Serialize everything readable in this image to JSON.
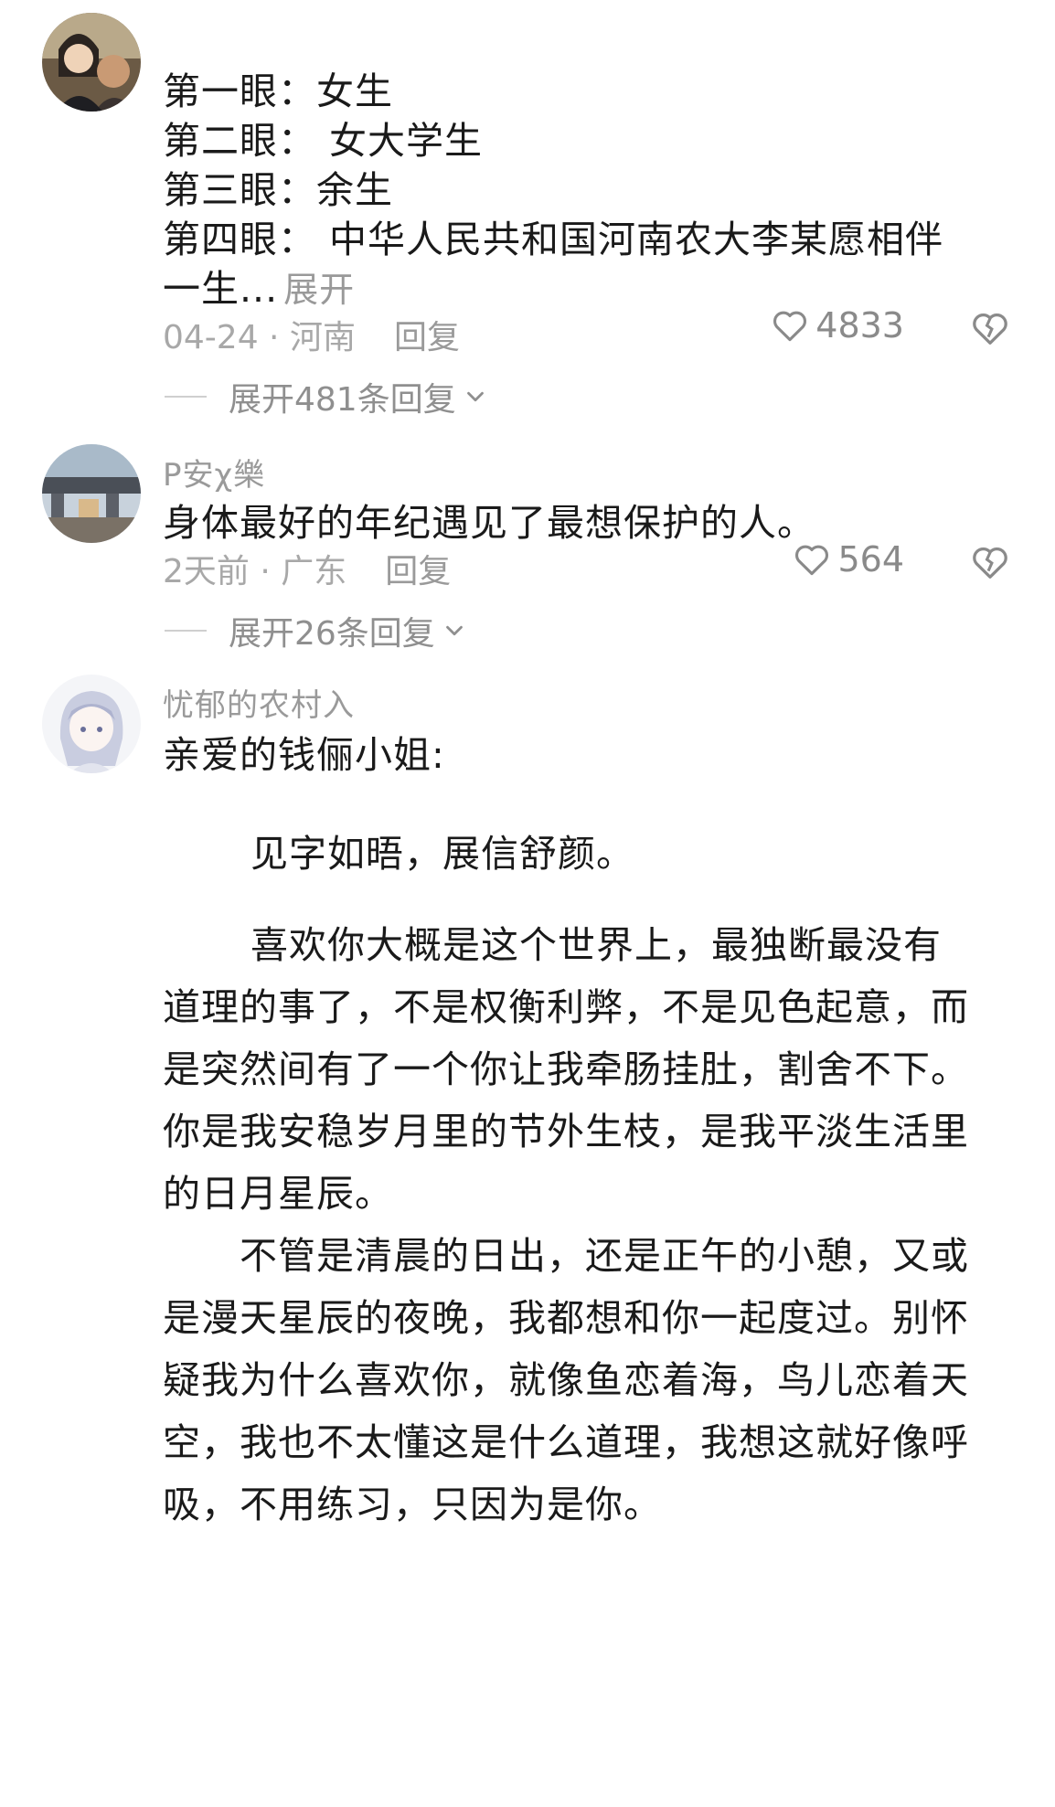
{
  "comments": [
    {
      "avatar": "photo-avatar-couple",
      "lines": [
        "第一眼：女生",
        "第二眼： 女大学生",
        "第三眼：余生",
        "第四眼： 中华人民共和国河南农大李某愿相伴",
        "一生..."
      ],
      "expand_label": "展开",
      "date": "04-24",
      "location": "河南",
      "reply_label": "回复",
      "likes": "4833",
      "replies_label": "展开481条回复"
    },
    {
      "avatar": "photo-avatar-street",
      "username": "P安χ樂",
      "text": "身体最好的年纪遇见了最想保护的人。",
      "date": "2天前",
      "location": "广东",
      "reply_label": "回复",
      "likes": "564",
      "replies_label": "展开26条回复"
    },
    {
      "avatar": "anime-avatar",
      "username": "忧郁的农村入",
      "salutation": "亲爱的钱俪小姐:",
      "greeting": "见字如晤，展信舒颜。",
      "para1": [
        "喜欢你大概是这个世界上，最独断最没有",
        "道理的事了，不是权衡利弊，不是见色起意，而",
        "是突然间有了一个你让我牵肠挂肚，割舍不下。",
        "你是我安稳岁月里的节外生枝，是我平淡生活里",
        "的日月星辰。"
      ],
      "para2": [
        "不管是清晨的日出，还是正午的小憩，又或",
        "是漫天星辰的夜晚，我都想和你一起度过。别怀",
        "疑我为什么喜欢你，就像鱼恋着海，鸟儿恋着天",
        "空，我也不太懂这是什么道理，我想这就好像呼",
        "吸，不用练习，只因为是你。"
      ]
    }
  ],
  "icons": {
    "like": "heart-outline-icon",
    "dislike": "broken-heart-icon",
    "chevron": "chevron-down-icon"
  }
}
